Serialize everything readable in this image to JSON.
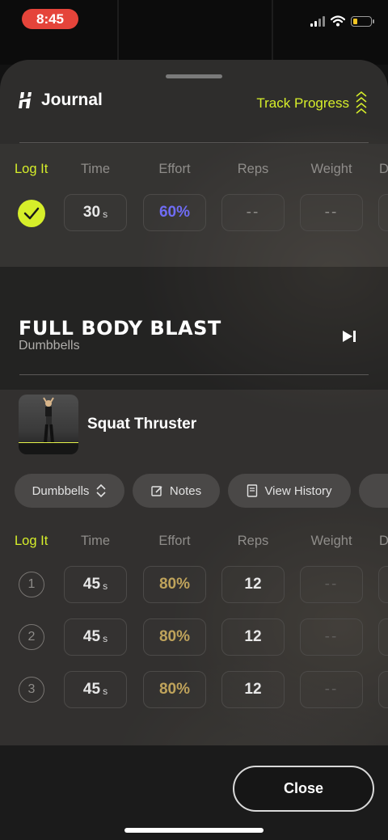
{
  "status": {
    "time": "8:45"
  },
  "header": {
    "title": "Journal",
    "track_label": "Track Progress"
  },
  "columns": {
    "log": "Log It",
    "time": "Time",
    "effort": "Effort",
    "reps": "Reps",
    "weight": "Weight",
    "next": "D"
  },
  "top_set": {
    "time": "30",
    "time_unit": "s",
    "effort": "60%",
    "reps": "--",
    "weight": "--"
  },
  "workout": {
    "title": "FULL BODY BLAST",
    "subtitle": "Dumbbells"
  },
  "exercise": {
    "name": "Squat Thruster",
    "chips": {
      "equipment": "Dumbbells",
      "notes": "Notes",
      "history": "View History"
    },
    "sets": [
      {
        "num": "1",
        "time": "45",
        "unit": "s",
        "effort": "80%",
        "reps": "12",
        "weight": "--"
      },
      {
        "num": "2",
        "time": "45",
        "unit": "s",
        "effort": "80%",
        "reps": "12",
        "weight": "--"
      },
      {
        "num": "3",
        "time": "45",
        "unit": "s",
        "effort": "80%",
        "reps": "12",
        "weight": "--"
      }
    ]
  },
  "footer": {
    "close_label": "Close"
  },
  "colors": {
    "accent": "#d6ee2a",
    "effort_blue": "#6f6cf4",
    "effort_gold": "#bfa35b",
    "status_red": "#e5443a"
  }
}
